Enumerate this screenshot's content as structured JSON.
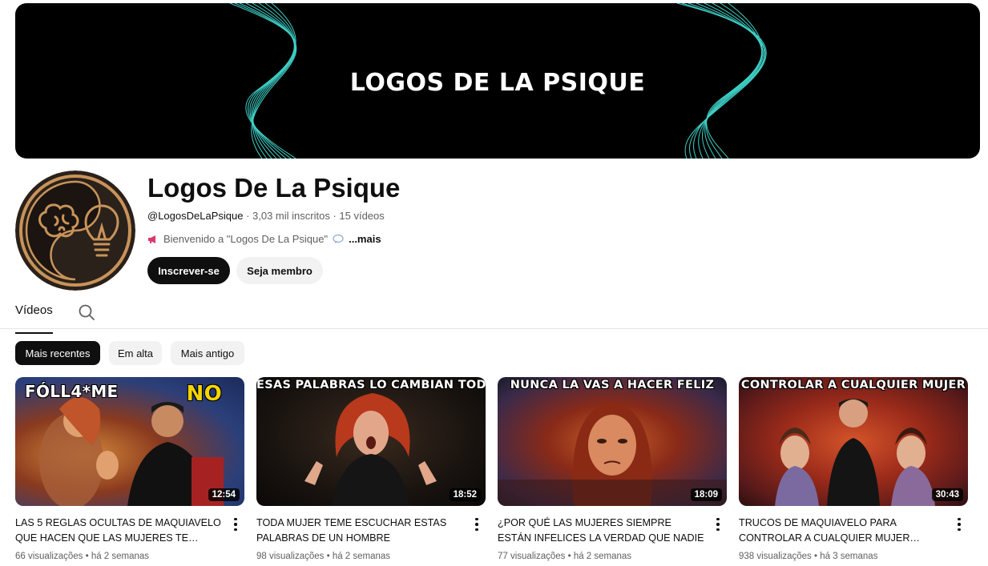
{
  "banner": {
    "title": "LOGOS DE LA PSIQUE"
  },
  "channel": {
    "name": "Logos De La Psique",
    "handle": "@LogosDeLaPsique",
    "subscribers": "3,03 mil inscritos",
    "video_count": "15 vídeos",
    "separator": " · ",
    "description": "Bienvenido a \"Logos De La Psique\"",
    "more_label": "...mais",
    "subscribe_label": "Inscrever-se",
    "member_label": "Seja membro"
  },
  "tabs": {
    "videos_label": "Vídeos"
  },
  "chips": [
    {
      "label": "Mais recentes"
    },
    {
      "label": "Em alta"
    },
    {
      "label": "Mais antigo"
    }
  ],
  "videos": [
    {
      "thumb_text": "FÓLL4*ME",
      "thumb_text_2": "NO",
      "duration": "12:54",
      "title": "LAS 5 REGLAS OCULTAS DE MAQUIAVELO QUE HACEN QUE LAS MUJERES TE…",
      "views": "66 visualizações",
      "age": "há 2 semanas"
    },
    {
      "thumb_text": "ESAS PALABRAS LO CAMBIAN TODO",
      "duration": "18:52",
      "title": "TODA MUJER TEME ESCUCHAR ESTAS PALABRAS DE UN HOMBRE",
      "views": "98 visualizações",
      "age": "há 2 semanas"
    },
    {
      "thumb_text": "NUNCA LA VAS A HACER FELIZ",
      "duration": "18:09",
      "title": "¿POR QUÉ LAS MUJERES SIEMPRE ESTÁN INFELICES LA VERDAD QUE NADIE TE DICE",
      "views": "77 visualizações",
      "age": "há 2 semanas"
    },
    {
      "thumb_text": "CONTROLAR A CUALQUIER MUJER",
      "duration": "30:43",
      "title": "TRUCOS DE MAQUIAVELO PARA CONTROLAR A CUALQUIER MUJER…",
      "views": "938 visualizações",
      "age": "há 3 semanas"
    }
  ],
  "icons": {
    "search": "search-icon",
    "megaphone": "megaphone-icon",
    "speech": "speech-bubble-icon",
    "more_vert": "more-vert-icon"
  },
  "colors": {
    "accent_dark": "#0f0f0f",
    "banner_wave": "#3fd1c7",
    "avatar_gold": "#c8935a",
    "avatar_bg": "#2a211a"
  }
}
